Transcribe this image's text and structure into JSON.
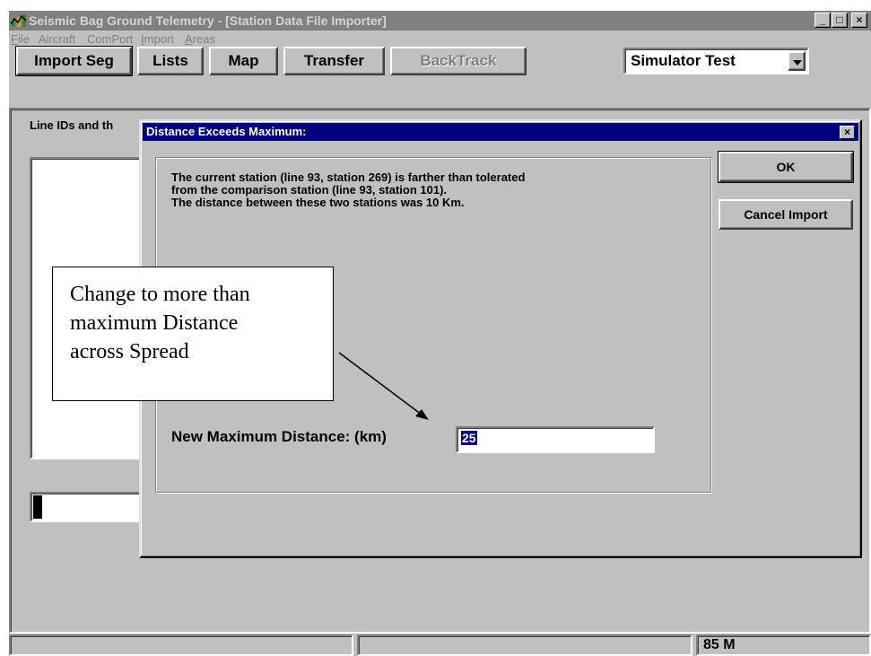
{
  "window": {
    "title": "Seismic Bag Ground Telemetry - [Station Data File Importer]",
    "controls": {
      "minimize": "_",
      "maximize": "□",
      "close": "×"
    }
  },
  "menu": [
    {
      "label": "File",
      "accel": "F",
      "rest": "ile"
    },
    {
      "label": "Aircraft",
      "accel": "",
      "rest": "Aircraft"
    },
    {
      "label": "ComPort",
      "accel": "",
      "rest": "ComPort"
    },
    {
      "label": "Import",
      "accel": "I",
      "rest": "mport"
    },
    {
      "label": "Areas",
      "accel": "A",
      "rest": "reas"
    }
  ],
  "toolbar": {
    "tabs": [
      "Import Seg",
      "Lists",
      "Map",
      "Transfer",
      "BackTrack"
    ],
    "active_tab": "Import Seg",
    "disabled_tab": "BackTrack",
    "mode_select": "Simulator Test"
  },
  "left_panel": {
    "label": "Line IDs and th",
    "progress": 0.08
  },
  "status_bar": {
    "pane1": "",
    "pane2": "",
    "pane3": "85 M"
  },
  "dialog": {
    "title": "Distance Exceeds Maximum:",
    "message": [
      "The current station (line 93, station 269) is farther than tolerated",
      "from the comparison station (line 93, station 101).",
      "The distance between these two stations was 10 Km."
    ],
    "field_label": "New Maximum Distance: (km)",
    "field_value": "25",
    "ok_label": "OK",
    "cancel_label": "Cancel Import"
  },
  "annotation": {
    "lines": [
      "Change to more than",
      "maximum Distance",
      "across Spread"
    ]
  },
  "colors": {
    "face": "#c0c0c0",
    "dialog_title": "#000080",
    "inactive_title": "#808080",
    "selection": "#000080"
  }
}
